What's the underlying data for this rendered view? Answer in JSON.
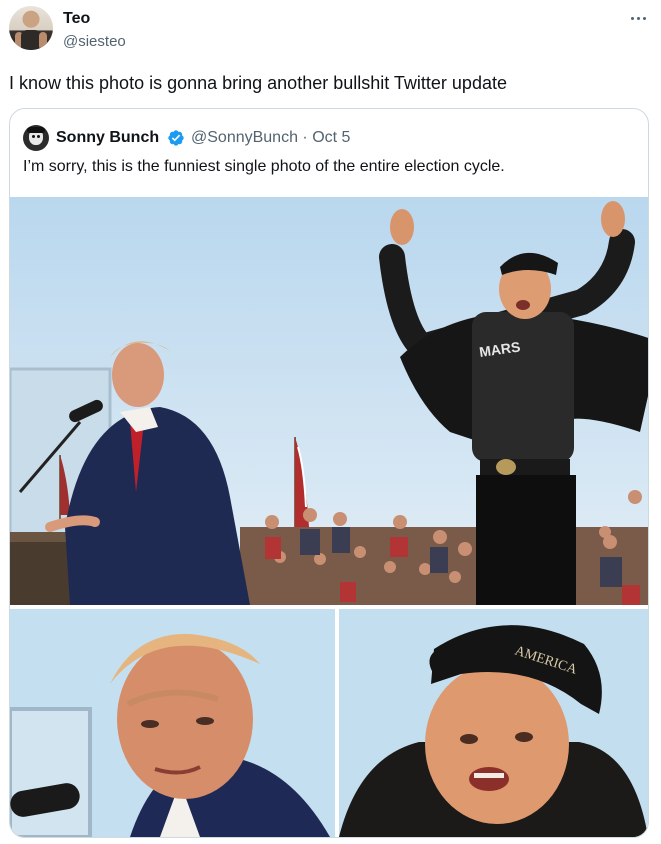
{
  "author": {
    "display_name": "Teo",
    "handle": "@siesteo",
    "avatar_icon": "user-avatar"
  },
  "tweet": {
    "text": "I know this photo is gonna bring another bullshit Twitter update",
    "more_icon": "more-horizontal-icon"
  },
  "quoted_tweet": {
    "display_name": "Sonny Bunch",
    "verified_icon": "verified-badge-icon",
    "handle_and_date": "@SonnyBunch · Oct 5",
    "text": "I’m sorry, this is the funniest single photo of the entire election cycle.",
    "media": [
      {
        "description_icon": "rally-photo-main"
      },
      {
        "description_icon": "rally-photo-closeup-left"
      },
      {
        "description_icon": "rally-photo-closeup-right"
      }
    ]
  },
  "colors": {
    "text_primary": "#0f1419",
    "text_secondary": "#536471",
    "border": "#cfd9de",
    "verified": "#1d9bf0"
  }
}
